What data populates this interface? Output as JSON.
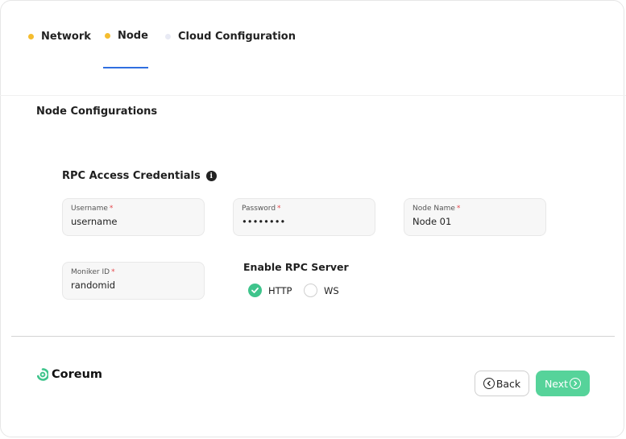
{
  "tabs": [
    {
      "label": "Network",
      "dot_color": "#f5bd2f"
    },
    {
      "label": "Node",
      "dot_color": "#f5bd2f"
    },
    {
      "label": "Cloud Configuration",
      "dot_color": "#e8eaf4"
    }
  ],
  "colors": {
    "accent": "#56d39a",
    "active_tab": "#2f6fe0",
    "required": "#e5484d"
  },
  "section_title": "Node Configurations",
  "credentials": {
    "title": "RPC Access Credentials",
    "info_icon": "i",
    "username": {
      "label": "Username",
      "required": "*",
      "value": "username"
    },
    "password": {
      "label": "Password",
      "required": "*",
      "value": "••••••••"
    },
    "node_name": {
      "label": "Node Name",
      "required": "*",
      "value": "Node 01"
    },
    "moniker_id": {
      "label": "Moniker ID",
      "required": "*",
      "value": "randomid"
    }
  },
  "rpc_server": {
    "title": "Enable RPC Server",
    "options": [
      {
        "label": "HTTP",
        "checked": true
      },
      {
        "label": "WS",
        "checked": false
      }
    ]
  },
  "footer": {
    "brand": "Coreum",
    "back_label": "Back",
    "next_label": "Next"
  }
}
